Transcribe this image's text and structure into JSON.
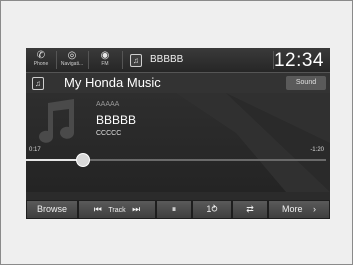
{
  "status_bar": {
    "phone_label": "Phone",
    "phone_icon": "phone-icon",
    "navi_label": "Navigati...",
    "navi_icon": "navigation-icon",
    "fm_label": "FM",
    "fm_icon": "radio-icon",
    "source_icon": "music-note-icon",
    "track_name": "BBBBB",
    "clock": "12:34"
  },
  "header": {
    "source_icon": "music-note-icon",
    "title": "My Honda Music",
    "sound_button": "Sound"
  },
  "now_playing": {
    "artist": "AAAAA",
    "song": "BBBBB",
    "album": "CCCCC",
    "elapsed": "0:17",
    "remaining": "-1:20",
    "progress_fraction": 0.19
  },
  "controls": {
    "browse": "Browse",
    "prev_glyph": "⏮",
    "track_label": "Track",
    "next_glyph": "⏭",
    "pause_glyph": "⏸",
    "repeat_glyph": "1⥁",
    "shuffle_glyph": "⇄",
    "more_label": "More",
    "more_chevron": "›"
  },
  "colors": {
    "screen_bg": "#2b2b2b",
    "frame_bg": "#efefef"
  }
}
